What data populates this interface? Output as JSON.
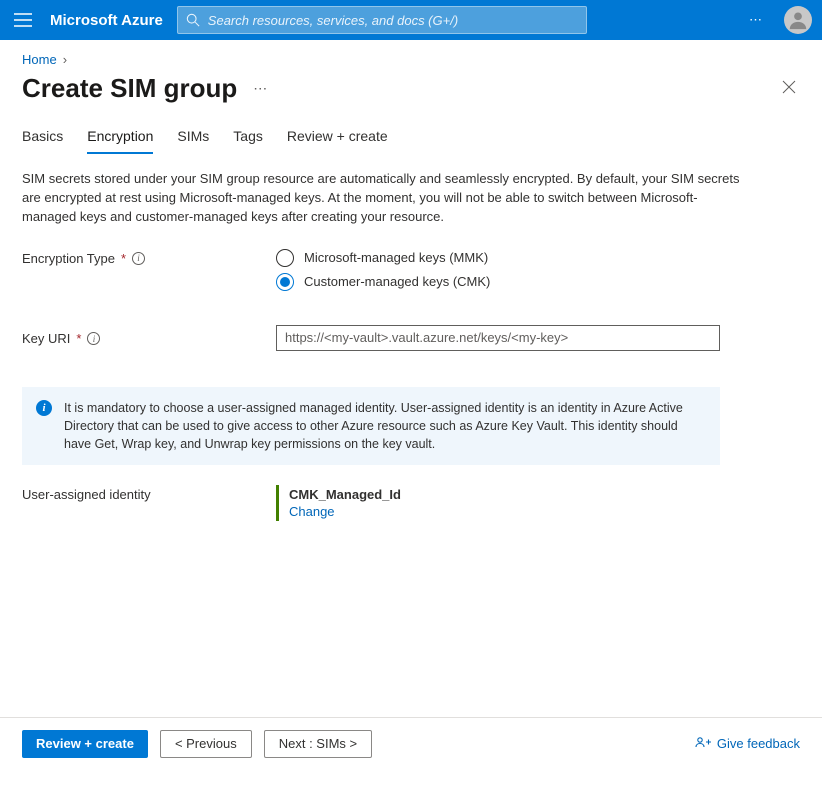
{
  "topbar": {
    "brand": "Microsoft Azure",
    "search_placeholder": "Search resources, services, and docs (G+/)"
  },
  "breadcrumb": {
    "home": "Home"
  },
  "page": {
    "title": "Create SIM group"
  },
  "tabs": {
    "basics": "Basics",
    "encryption": "Encryption",
    "sims": "SIMs",
    "tags": "Tags",
    "review": "Review + create"
  },
  "form": {
    "description": "SIM secrets stored under your SIM group resource are automatically and seamlessly encrypted. By default, your SIM secrets are encrypted at rest using Microsoft-managed keys. At the moment, you will not be able to switch between Microsoft-managed keys and customer-managed keys after creating your resource.",
    "encryption_type_label": "Encryption Type",
    "option_mmk": "Microsoft-managed keys (MMK)",
    "option_cmk": "Customer-managed keys (CMK)",
    "key_uri_label": "Key URI",
    "key_uri_placeholder": "https://<my-vault>.vault.azure.net/keys/<my-key>",
    "info_banner": "It is mandatory to choose a user-assigned managed identity. User-assigned identity is an identity in Azure Active Directory that can be used to give access to other Azure resource such as Azure Key Vault. This identity should have Get, Wrap key, and Unwrap key permissions on the key vault.",
    "identity_label": "User-assigned identity",
    "identity_value": "CMK_Managed_Id",
    "identity_change": "Change"
  },
  "footer": {
    "review": "Review + create",
    "previous": "< Previous",
    "next": "Next : SIMs >",
    "feedback": "Give feedback"
  }
}
